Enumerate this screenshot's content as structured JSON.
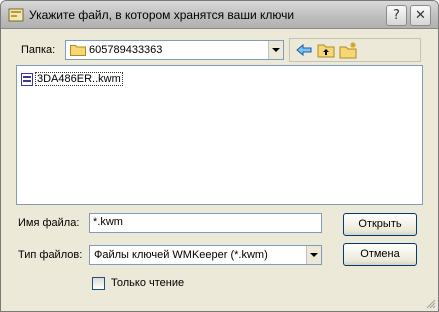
{
  "window": {
    "title": "Укажите файл, в котором хранятся ваши ключи",
    "help_btn": "?",
    "close_btn": "✕"
  },
  "lookin": {
    "label": "Папка:",
    "value": "605789433363"
  },
  "files": [
    {
      "name": "3DA486ER..kwm"
    }
  ],
  "filename": {
    "label": "Имя файла:",
    "value": "*.kwm"
  },
  "filetype": {
    "label": "Тип файлов:",
    "value": "Файлы ключей WMKeeper (*.kwm)"
  },
  "buttons": {
    "open": "Открыть",
    "cancel": "Отмена"
  },
  "readonly": {
    "label": "Только чтение",
    "checked": false
  }
}
